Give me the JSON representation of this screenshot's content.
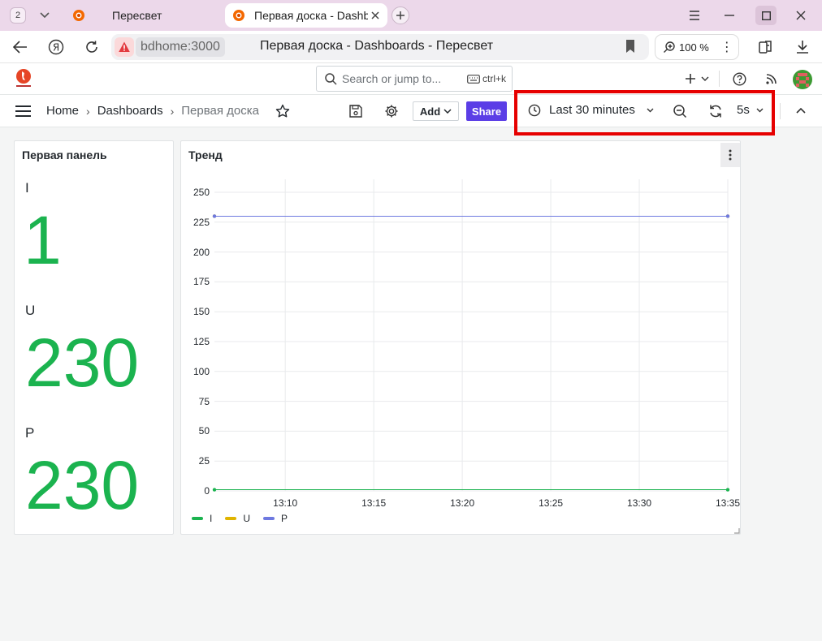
{
  "browser": {
    "tab_count": "2",
    "tabs": [
      {
        "title": "Пересвет",
        "active": false
      },
      {
        "title": "Первая доска - Dashboards - Пересвет",
        "active": true
      }
    ],
    "url_host": "bdhome:3000",
    "page_title": "Первая доска - Dashboards - Пересвет",
    "zoom": "100 %"
  },
  "grafana": {
    "search_placeholder": "Search or jump to...",
    "search_shortcut": "ctrl+k",
    "breadcrumbs": [
      "Home",
      "Dashboards",
      "Первая доска"
    ],
    "add_label": "Add",
    "share_label": "Share",
    "time_range": "Last 30 minutes",
    "refresh_interval": "5s"
  },
  "panels": {
    "stat": {
      "title": "Первая панель",
      "items": [
        {
          "label": "I",
          "value": "1"
        },
        {
          "label": "U",
          "value": "230"
        },
        {
          "label": "P",
          "value": "230"
        }
      ]
    },
    "trend": {
      "title": "Тренд"
    }
  },
  "colors": {
    "accent": "#5b3ee6",
    "stat_green": "#1bb34f",
    "highlight": "#e60000"
  },
  "chart_data": {
    "type": "line",
    "x": [
      "13:06",
      "13:35"
    ],
    "x_tick_labels": [
      "13:10",
      "13:15",
      "13:20",
      "13:25",
      "13:30",
      "13:35"
    ],
    "y_tick_labels": [
      "0",
      "25",
      "50",
      "75",
      "100",
      "125",
      "150",
      "175",
      "200",
      "225",
      "250"
    ],
    "ylim": [
      0,
      250
    ],
    "grid": true,
    "legend_placement": "bottom-left",
    "series": [
      {
        "name": "I",
        "color": "#1bb34f",
        "values": [
          1,
          1
        ]
      },
      {
        "name": "U",
        "color": "#e0b400",
        "values": [
          230,
          230
        ]
      },
      {
        "name": "P",
        "color": "#6e79e0",
        "values": [
          230,
          230
        ]
      }
    ]
  }
}
